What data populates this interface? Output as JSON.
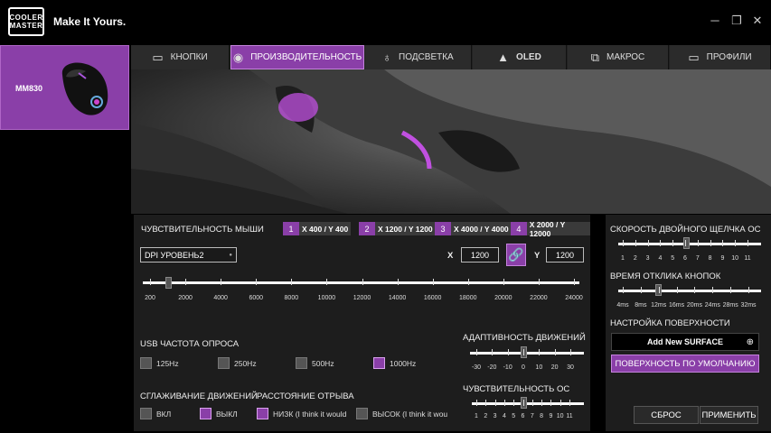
{
  "brand": {
    "logo_line1": "COOLER",
    "logo_line2": "MASTER",
    "tagline": "Make It Yours."
  },
  "window": {
    "minimize": "─",
    "maximize": "❐",
    "close": "✕"
  },
  "device": {
    "name": "MM830"
  },
  "tabs": [
    {
      "label": "КНОПКИ",
      "icon": "keyboard-icon"
    },
    {
      "label": "ПРОИЗВОДИТЕЛЬНОСТЬ",
      "icon": "performance-icon"
    },
    {
      "label": "ПОДСВЕТКА",
      "icon": "bulb-icon"
    },
    {
      "label": "OLED",
      "icon": "oled-icon"
    },
    {
      "label": "МАКРОС",
      "icon": "macro-icon"
    },
    {
      "label": "ПРОФИЛИ",
      "icon": "profile-icon"
    }
  ],
  "sensitivity": {
    "title": "ЧУВСТВИТЕЛЬНОСТЬ МЫШИ",
    "levels": [
      {
        "num": "1",
        "value": "X 400 / Y 400"
      },
      {
        "num": "2",
        "value": "X 1200 / Y 1200"
      },
      {
        "num": "3",
        "value": "X 4000 / Y 4000"
      },
      {
        "num": "4",
        "value": "X 2000 / Y 12000"
      }
    ],
    "dpi_select": "DPI УРОВЕНЬ2",
    "x_label": "X",
    "x_value": "1200",
    "y_label": "Y",
    "y_value": "1200",
    "scale": [
      "200",
      "2000",
      "4000",
      "6000",
      "8000",
      "10000",
      "12000",
      "14000",
      "16000",
      "18000",
      "20000",
      "22000",
      "24000"
    ],
    "slider_value": 1200
  },
  "polling": {
    "title": "USB ЧАСТОТА ОПРОСА",
    "options": [
      {
        "label": "125Hz",
        "checked": false
      },
      {
        "label": "250Hz",
        "checked": false
      },
      {
        "label": "500Hz",
        "checked": false
      },
      {
        "label": "1000Hz",
        "checked": true
      }
    ]
  },
  "angle": {
    "title": "СГЛАЖИВАНИЕ ДВИЖЕНИЙ",
    "options": [
      {
        "label": "ВКЛ",
        "checked": false
      },
      {
        "label": "ВЫКЛ",
        "checked": true
      }
    ]
  },
  "lod": {
    "title": "РАССТОЯНИЕ ОТРЫВА",
    "options": [
      {
        "label": "НИЗК (I think it would",
        "checked": true
      },
      {
        "label": "ВЫСОК (I think it wou",
        "checked": false
      }
    ]
  },
  "adaptive": {
    "title": "АДАПТИВНОСТЬ ДВИЖЕНИЙ",
    "scale": [
      "-30",
      "-20",
      "-10",
      "0",
      "10",
      "20",
      "30"
    ],
    "value": 0
  },
  "os_sens": {
    "title": "ЧУВСТВИТЕЛЬНОСТЬ ОС",
    "scale": [
      "1",
      "2",
      "3",
      "4",
      "5",
      "6",
      "7",
      "8",
      "9",
      "10",
      "11"
    ],
    "value": 6
  },
  "double_click": {
    "title": "СКОРОСТЬ ДВОЙНОГО ЩЕЛЧКА ОС",
    "scale": [
      "1",
      "2",
      "3",
      "4",
      "5",
      "6",
      "7",
      "8",
      "9",
      "10",
      "11"
    ],
    "value": 6
  },
  "response": {
    "title": "ВРЕМЯ ОТКЛИКА КНОПОК",
    "scale": [
      "4ms",
      "8ms",
      "12ms",
      "16ms",
      "20ms",
      "24ms",
      "28ms",
      "32ms"
    ],
    "value_ms": 12
  },
  "surface": {
    "title": "НАСТРОЙКА ПОВЕРХНОСТИ",
    "add_label": "Add New SURFACE",
    "add_icon": "plus-circle-icon",
    "default_label": "ПОВЕРХНОСТЬ ПО УМОЛЧАНИЮ"
  },
  "actions": {
    "reset": "СБРОС",
    "apply": "ПРИМЕНИТЬ"
  },
  "colors": {
    "accent": "#8a3fa8",
    "panel": "#1e1e1e"
  }
}
